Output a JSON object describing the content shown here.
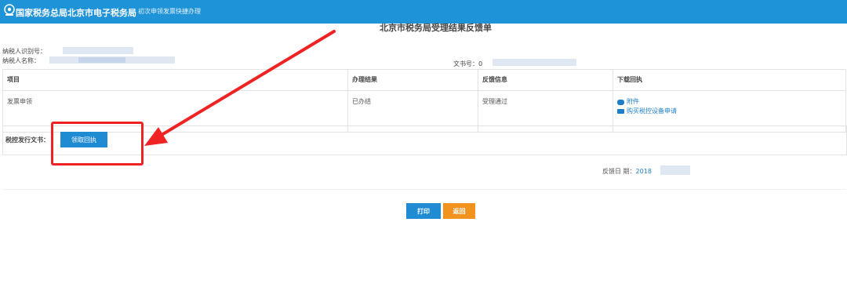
{
  "header": {
    "brand": "国家税务总局北京市电子税务局",
    "subtitle": "初次申领发票快捷办理"
  },
  "document": {
    "title": "北京市税务局受理结果反馈单",
    "taxpayer_id_label": "纳税人识别号：",
    "taxpayer_name_label": "纳税人名称：",
    "doc_no_label": "文书号：",
    "doc_no_value": "0"
  },
  "table": {
    "columns": [
      "项目",
      "办理结果",
      "反馈信息",
      "下载回执"
    ],
    "rows": [
      {
        "item": "发票申领",
        "result": "已办结",
        "feedback": "受理通过",
        "downloads": [
          "附件",
          "购买税控设备申请"
        ]
      }
    ]
  },
  "tax_control": {
    "label": "税控发行文书：",
    "button": "领取回执"
  },
  "feedback_date": {
    "label": "反馈日 期：",
    "value": "2018"
  },
  "actions": {
    "print": "打印",
    "back": "返回"
  },
  "colors": {
    "header_bg": "#1e93d8",
    "primary_button": "#1e8bd3",
    "back_button": "#f29320",
    "annotation_red": "#ef2323"
  },
  "icons": {
    "logo": "tax-bureau-logo-icon",
    "attachment": "cloud-download-icon",
    "device_request": "card-icon"
  }
}
